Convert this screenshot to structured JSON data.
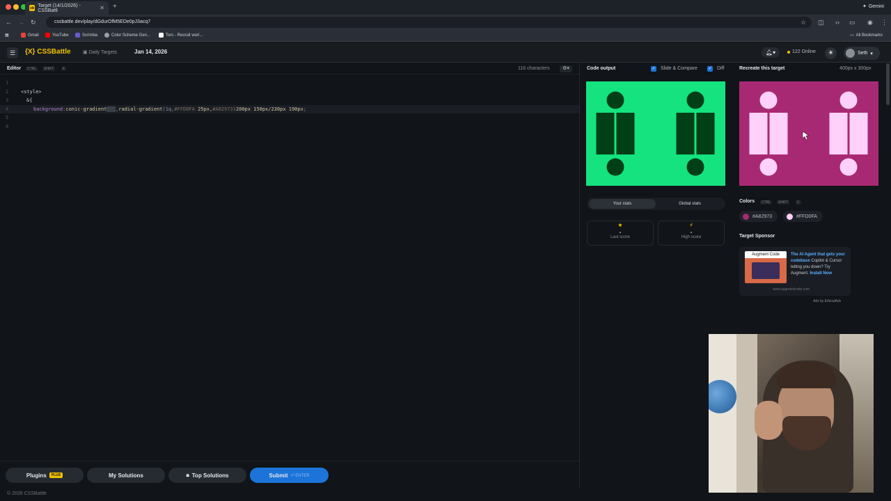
{
  "browser": {
    "tab_title": "Target (14/1/2026) - CSSBattl",
    "tab_favicon": "cb",
    "url": "cssbattle.dev/play/dGdurOfM5EDe0pJ3acq7",
    "gemini_label": "Gemini",
    "bookmarks": [
      "Gmail",
      "YouTube",
      "Scrimba",
      "Color Scheme Gen...",
      "Torc - Recruit worl..."
    ],
    "all_bookmarks": "All Bookmarks"
  },
  "header": {
    "logo": "{X} CSSBattle",
    "daily_targets": "Daily Targets",
    "date": "Jan 14, 2026",
    "online_count": "122 Online",
    "user_name": "Seth"
  },
  "editor": {
    "title": "Editor",
    "shortcut": [
      "CTRL",
      "SHIFT",
      "E"
    ],
    "char_count": "116 characters",
    "lines": [
      {
        "num": "1",
        "text": ""
      },
      {
        "num": "2",
        "text": "<style>"
      },
      {
        "num": "3",
        "text": "&{"
      },
      {
        "num": "4",
        "parts": [
          "background",
          ":",
          "conic-gradient",
          "(  )",
          ",",
          "radial-gradient",
          "(1q,",
          "#FFD0FA",
          " 25px,",
          "#A82973",
          ")",
          "200px 150px/230px 190px",
          ";"
        ]
      },
      {
        "num": "5",
        "text": ""
      },
      {
        "num": "6",
        "text": ""
      }
    ]
  },
  "toolbar": {
    "plugins": "Plugins",
    "plus_badge": "PLUS",
    "my_solutions": "My Solutions",
    "top_solutions": "Top Solutions",
    "submit": "Submit",
    "submit_hint": "ENTER"
  },
  "footer": "© 2026 CSSBattle",
  "output": {
    "title": "Code output",
    "slide_compare": "Slide & Compare",
    "diff": "Diff",
    "bg_color": "#14E37F",
    "shape_color": "#013F16"
  },
  "target": {
    "title": "Recreate this target",
    "size": "400px x 300px",
    "bg_color": "#A82973",
    "shape_color": "#FFD0FA"
  },
  "stats": {
    "your_stats": "Your stats",
    "global_stats": "Global stats",
    "last_score_label": "Last score",
    "last_score_value": "-",
    "high_score_label": "High score",
    "high_score_value": "-"
  },
  "colors": {
    "title": "Colors",
    "shortcut": [
      "CTRL",
      "SHIFT",
      "C"
    ],
    "swatches": [
      {
        "hex": "#A82973",
        "label": "#A82973"
      },
      {
        "hex": "#FFD0FA",
        "label": "#FFD0FA"
      }
    ]
  },
  "sponsor": {
    "title": "Target Sponsor",
    "image_title": "Augment Code",
    "headline": "The AI Agent that gets your codebase",
    "body": "Copilot & Cursor letting you down? Try Augment.",
    "cta": "Install Now",
    "url": "www.augmentcode.com",
    "ads_by": "Ads by EthicalAds"
  }
}
